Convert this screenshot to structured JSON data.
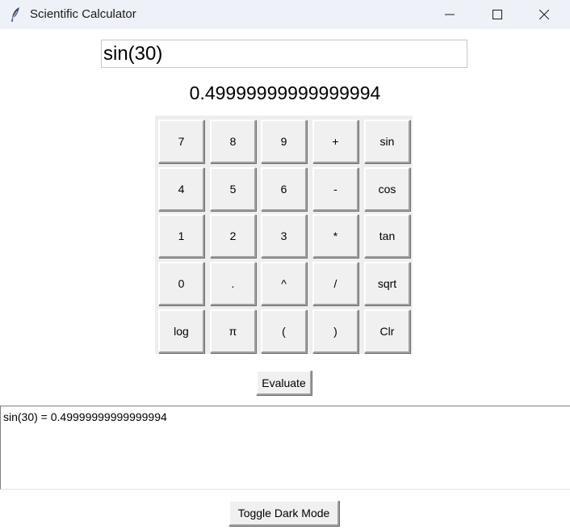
{
  "window": {
    "title": "Scientific Calculator",
    "icon": "feather-icon",
    "controls": [
      "minimize-icon",
      "maximize-icon",
      "close-icon"
    ]
  },
  "entry": {
    "value": "sin(30)"
  },
  "result": {
    "value": "0.49999999999999994"
  },
  "keypad": {
    "rows": [
      [
        "7",
        "8",
        "9",
        "+",
        "sin"
      ],
      [
        "4",
        "5",
        "6",
        "-",
        "cos"
      ],
      [
        "1",
        "2",
        "3",
        "*",
        "tan"
      ],
      [
        "0",
        ".",
        "^",
        "/",
        "sqrt"
      ],
      [
        "log",
        "π",
        "(",
        ")",
        "Clr"
      ]
    ]
  },
  "evaluate_label": "Evaluate",
  "history": {
    "lines": [
      "sin(30) = 0.49999999999999994"
    ]
  },
  "toggle_label": "Toggle Dark Mode",
  "colors": {
    "titlebar": "#eef2f8",
    "button_face": "#f0f0f0",
    "keypad_bg": "#eeeeee",
    "window_bg": "#ffffff"
  }
}
